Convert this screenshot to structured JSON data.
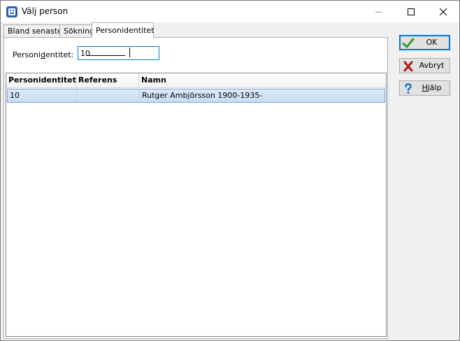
{
  "window": {
    "title": "Välj person"
  },
  "tabs": [
    {
      "label": "Bland senaste"
    },
    {
      "label": "Sökning"
    },
    {
      "label": "Personidentitet",
      "active": true
    }
  ],
  "form": {
    "pid_label_before": "Personi",
    "pid_label_accel": "d",
    "pid_label_after": "entitet:",
    "pid_value": "10"
  },
  "grid": {
    "columns": [
      "Personidentitet",
      "Referens",
      "Namn"
    ],
    "rows": [
      {
        "pid": "10",
        "ref": "",
        "name": "Rutger Ambjörsson 1900-1935-",
        "selected": true
      }
    ]
  },
  "buttons": {
    "ok": "OK",
    "cancel": "Avbryt",
    "help_accel": "H",
    "help_rest": "jälp"
  },
  "icons": {
    "app": "app-icon",
    "ok": "check-icon",
    "cancel": "x-icon",
    "help": "question-icon"
  },
  "colors": {
    "accent": "#0078d7",
    "selection": "#cde3f7",
    "ok_green": "#2e9e2e",
    "cancel_red": "#b01818",
    "help_blue": "#1e6fd0"
  }
}
